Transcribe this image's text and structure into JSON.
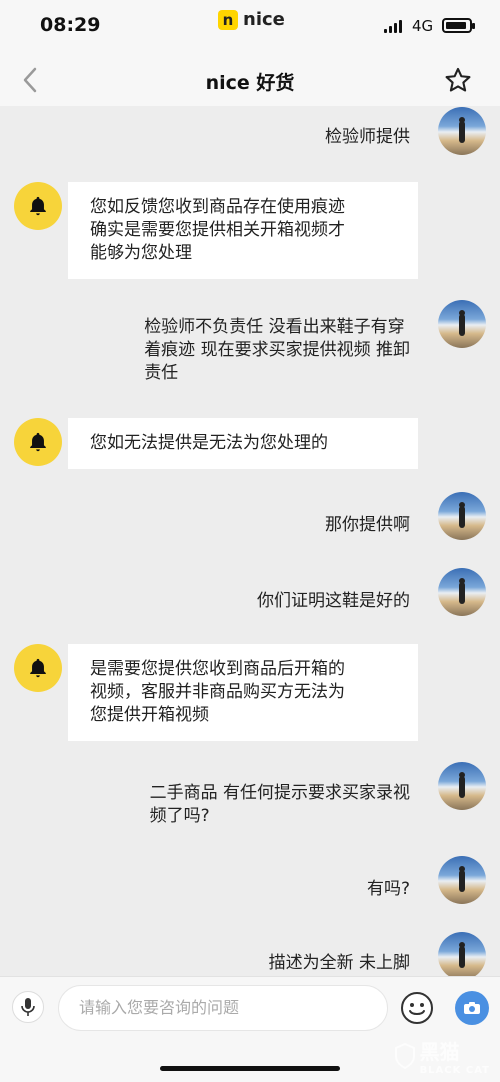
{
  "status_bar": {
    "time": "08:29",
    "app_name": "nice",
    "app_mark": "n",
    "network": "4G"
  },
  "header": {
    "back_icon": "chevron-left-icon",
    "title": "nice 好货",
    "favorite_icon": "star-icon"
  },
  "messages": [
    {
      "side": "right",
      "lines": [
        "检验师提供"
      ]
    },
    {
      "side": "left",
      "lines": [
        "您如反馈您收到商品存在使用痕迹",
        "确实是需要您提供相关开箱视频才",
        "能够为您处理"
      ]
    },
    {
      "side": "right",
      "lines": [
        "检验师不负责任 没看出来鞋子有穿",
        "着痕迹 现在要求买家提供视频 推卸",
        "责任"
      ]
    },
    {
      "side": "left",
      "lines": [
        "您如无法提供是无法为您处理的"
      ]
    },
    {
      "side": "right",
      "lines": [
        "那你提供啊"
      ]
    },
    {
      "side": "right",
      "lines": [
        "你们证明这鞋是好的"
      ]
    },
    {
      "side": "left",
      "lines": [
        "是需要您提供您收到商品后开箱的",
        "视频，客服并非商品购买方无法为",
        "您提供开箱视频"
      ]
    },
    {
      "side": "right",
      "lines": [
        "二手商品 有任何提示要求买家录视",
        "频了吗?"
      ]
    },
    {
      "side": "right",
      "lines": [
        "有吗?"
      ]
    },
    {
      "side": "right",
      "lines": [
        "描述为全新 未上脚"
      ]
    }
  ],
  "input_bar": {
    "placeholder": "请输入您要咨询的问题"
  },
  "watermark": {
    "cn": "黑猫",
    "en": "BLACK CAT"
  }
}
